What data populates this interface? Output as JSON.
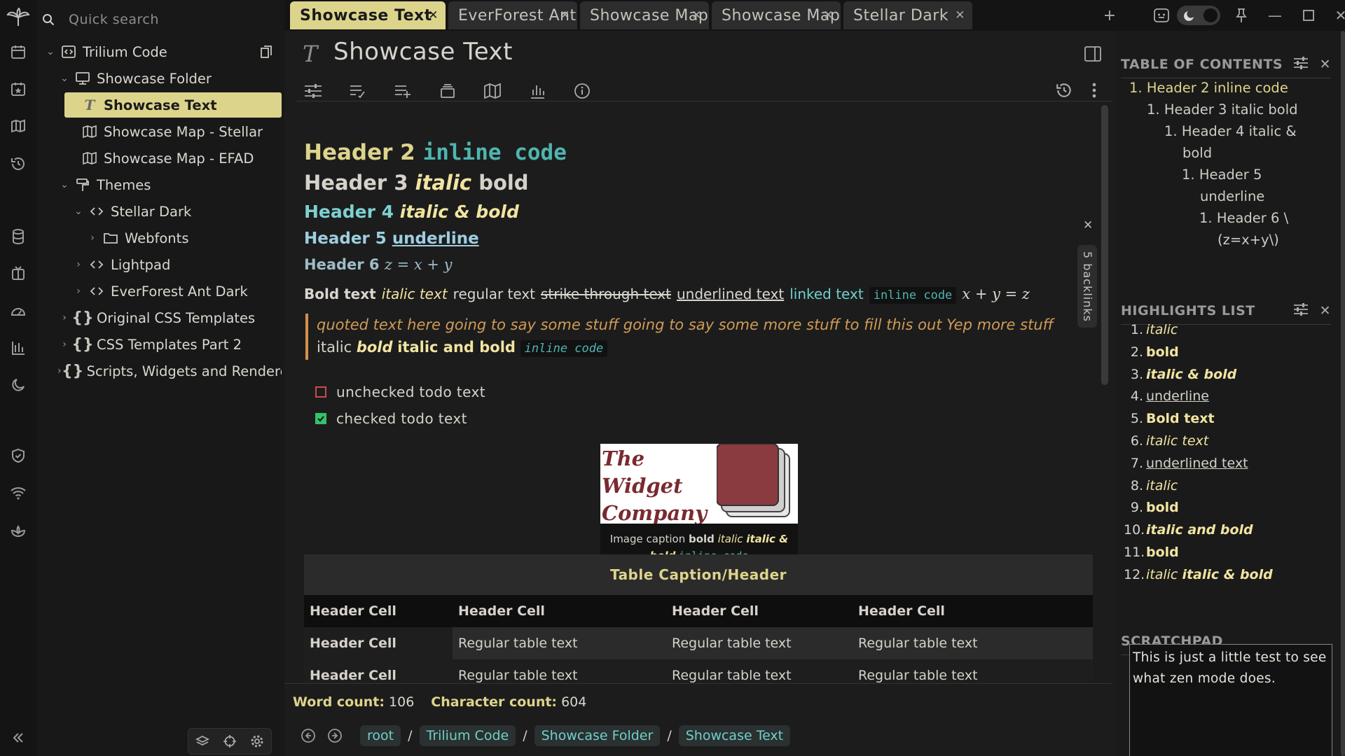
{
  "search": {
    "placeholder": "Quick search"
  },
  "tree": {
    "items": [
      {
        "label": "Trilium Code",
        "icon": "code-square-icon"
      },
      {
        "label": "Showcase Folder",
        "icon": "monitor-icon"
      },
      {
        "label": "Showcase Text",
        "icon": "text-t-icon"
      },
      {
        "label": "Showcase Map - Stellar",
        "icon": "map-icon"
      },
      {
        "label": "Showcase Map - EFAD",
        "icon": "map-icon"
      },
      {
        "label": "Themes",
        "icon": "paint-roller-icon"
      },
      {
        "label": "Stellar Dark",
        "icon": "code-brackets-icon"
      },
      {
        "label": "Webfonts",
        "icon": "folder-icon"
      },
      {
        "label": "Lightpad",
        "icon": "code-brackets-icon"
      },
      {
        "label": "EverForest Ant Dark",
        "icon": "code-brackets-icon"
      },
      {
        "label": "Original CSS Templates",
        "icon": "braces-icon"
      },
      {
        "label": "CSS Templates Part 2",
        "icon": "braces-icon"
      },
      {
        "label": "Scripts, Widgets and Renderers",
        "icon": "braces-icon"
      }
    ]
  },
  "tabs": [
    {
      "label": "Showcase Text"
    },
    {
      "label": "EverForest Ant"
    },
    {
      "label": "Showcase Map -"
    },
    {
      "label": "Showcase Map"
    },
    {
      "label": "Stellar Dark"
    }
  ],
  "note": {
    "title": "Showcase Text",
    "title_icon": "T",
    "h2": {
      "text": "Header 2",
      "code": "inline code"
    },
    "h3": {
      "text": "Header 3",
      "italic": "italic",
      "bold": "bold"
    },
    "h4": {
      "text": "Header 4",
      "rest": "italic & bold"
    },
    "h5": {
      "text": "Header 5",
      "underline": "underline"
    },
    "h6": {
      "text": "Header 6",
      "math": "z = x + y"
    },
    "para": {
      "bold": "Bold text",
      "italic": "italic text",
      "regular": "regular text",
      "strike": "strike through text",
      "underline": "underlined text",
      "link": "linked text",
      "code": "inline code",
      "math": "x + y = z"
    },
    "quote": {
      "text": "quoted text here going to say some stuff going to say some more stuff to fill this out Yep more stuff",
      "italic": "italic",
      "bold_italic": "bold",
      "italic_and_bold": "italic and bold",
      "code": "inline code"
    },
    "todos": [
      {
        "text": "unchecked todo text",
        "checked": false
      },
      {
        "text": "checked todo text",
        "checked": true
      }
    ],
    "figure": {
      "logo_lines": [
        "The",
        "Widget",
        "Company"
      ],
      "caption_prefix": "Image caption",
      "caption_bold": "bold",
      "caption_italic": "italic",
      "caption_italic_bold": "italic & bold",
      "caption_code": "inline code"
    },
    "table": {
      "caption": "Table Caption/Header",
      "header": [
        "Header Cell",
        "Header Cell",
        "Header Cell",
        "Header Cell"
      ],
      "rows": [
        [
          "Header Cell",
          "Regular table text",
          "Regular table text",
          "Regular table text"
        ],
        [
          "Header Cell",
          "Regular table text",
          "Regular table text",
          "Regular table text"
        ]
      ]
    },
    "backlinks": "5 backlinks",
    "word_count_label": "Word count:",
    "word_count": "106",
    "char_count_label": "Character count:",
    "char_count": "604"
  },
  "breadcrumb": [
    "root",
    "Trilium Code",
    "Showcase Folder",
    "Showcase Text"
  ],
  "right": {
    "toc_title": "TABLE OF CONTENTS",
    "toc": [
      {
        "num": "1.",
        "lines": [
          "Header 2 inline code"
        ]
      },
      {
        "num": "1.",
        "lines": [
          "Header 3 italic bold"
        ]
      },
      {
        "num": "1.",
        "lines": [
          "Header 4 italic &",
          "bold"
        ]
      },
      {
        "num": "1.",
        "lines": [
          "Header 5",
          "underline"
        ]
      },
      {
        "num": "1.",
        "lines": [
          "Header 6 \\",
          "(z=x+y\\)"
        ]
      }
    ],
    "highlights_title": "HIGHLIGHTS LIST",
    "highlights": [
      {
        "n": "1.",
        "text": "italic"
      },
      {
        "n": "2.",
        "text": "bold"
      },
      {
        "n": "3.",
        "text": "italic & bold"
      },
      {
        "n": "4.",
        "text": "underline"
      },
      {
        "n": "5.",
        "text": "Bold text"
      },
      {
        "n": "6.",
        "text": "italic text"
      },
      {
        "n": "7.",
        "text": "underlined text"
      },
      {
        "n": "8.",
        "text": "italic"
      },
      {
        "n": "9.",
        "text": "bold"
      },
      {
        "n": "10.",
        "text": "italic and bold"
      },
      {
        "n": "11.",
        "text": "bold"
      },
      {
        "n": "12.",
        "text": "italic",
        "text2": "italic & bold"
      }
    ],
    "scratchpad_title": "SCRATCHPAD",
    "scratchpad_text": "This is just a little test to see what zen mode does."
  },
  "colors": {
    "accent": "#ddd48c",
    "code": "#4fb5b0",
    "quote": "#cf9b56",
    "link": "#6fd0cb"
  }
}
